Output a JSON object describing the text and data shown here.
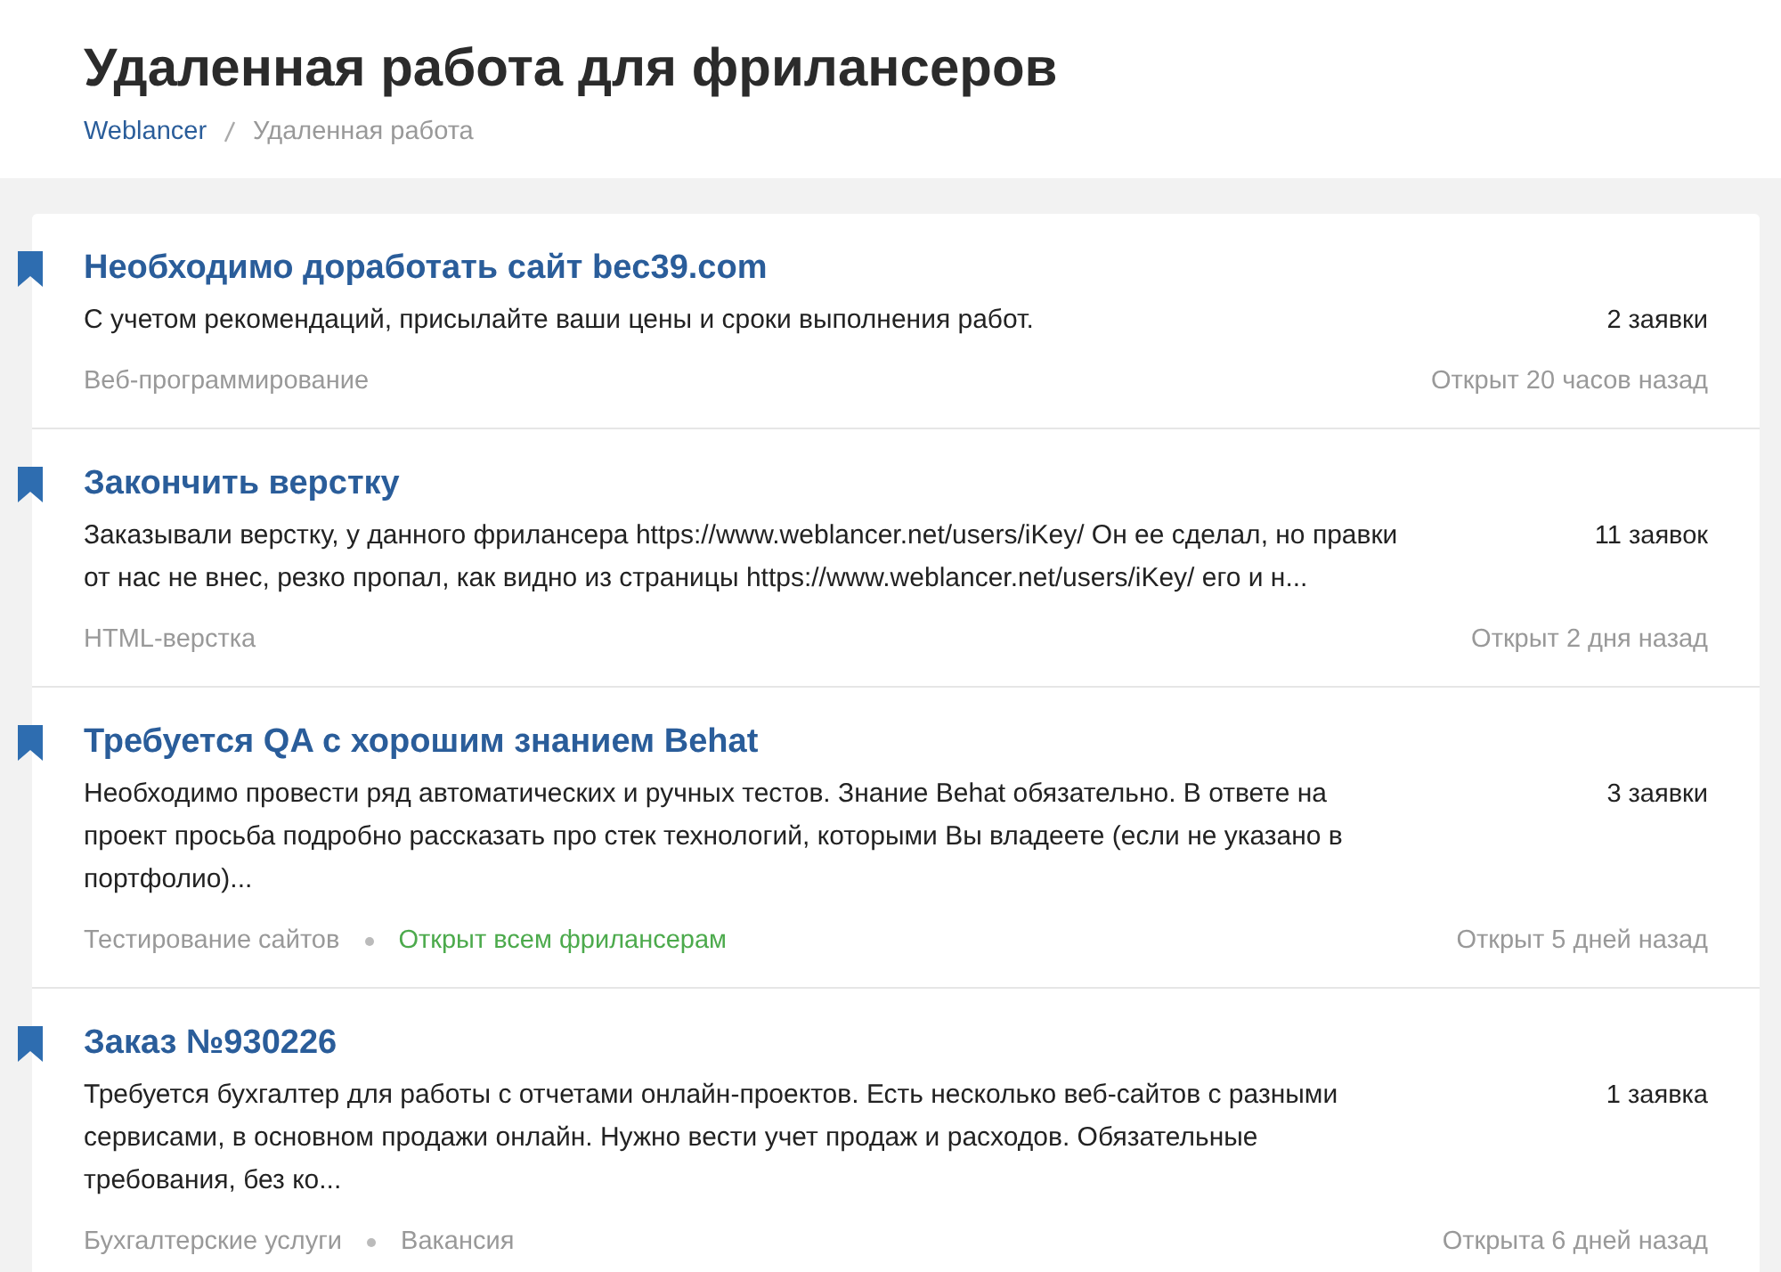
{
  "page": {
    "title": "Удаленная работа для фрилансеров"
  },
  "breadcrumbs": [
    {
      "label": "Weblancer",
      "kind": "link"
    },
    {
      "label": "Удаленная работа",
      "kind": "current"
    }
  ],
  "projects": [
    {
      "title": "Необходимо доработать сайт bec39.com",
      "description": "С учетом рекомендаций, присылайте ваши цены и сроки выполнения работ.",
      "bids": "2 заявки",
      "tags": [
        {
          "label": "Веб-программирование",
          "kind": "plain"
        }
      ],
      "opened": "Открыт 20 часов назад"
    },
    {
      "title": "Закончить верстку",
      "description": "Заказывали верстку, у данного фрилансера https://www.weblancer.net/users/iKey/ Он ее сделал, но правки от нас не внес, резко пропал, как видно из страницы https://www.weblancer.net/users/iKey/ его и н...",
      "bids": "11 заявок",
      "tags": [
        {
          "label": "HTML-верстка",
          "kind": "plain"
        }
      ],
      "opened": "Открыт 2 дня назад"
    },
    {
      "title": "Требуется QA с хорошим знанием Behat",
      "description": "Необходимо провести ряд автоматических и ручных тестов. Знание Behat обязательно. В ответе на проект просьба подробно рассказать про стек технологий, которыми Вы владеете (если не указано в портфолио)...",
      "bids": "3 заявки",
      "tags": [
        {
          "label": "Тестирование сайтов",
          "kind": "plain"
        },
        {
          "label": "Открыт всем фрилансерам",
          "kind": "highlight"
        }
      ],
      "opened": "Открыт 5 дней назад"
    },
    {
      "title": "Заказ №930226",
      "description": "Требуется бухгалтер для работы с отчетами онлайн-проектов. Есть несколько веб-сайтов с разными сервисами, в основном продажи онлайн. Нужно вести учет продаж и расходов. Обязательные требования, без ко...",
      "bids": "1 заявка",
      "tags": [
        {
          "label": "Бухгалтерские услуги",
          "kind": "plain"
        },
        {
          "label": "Вакансия",
          "kind": "plain"
        }
      ],
      "opened": "Открыта 6 дней назад"
    }
  ]
}
